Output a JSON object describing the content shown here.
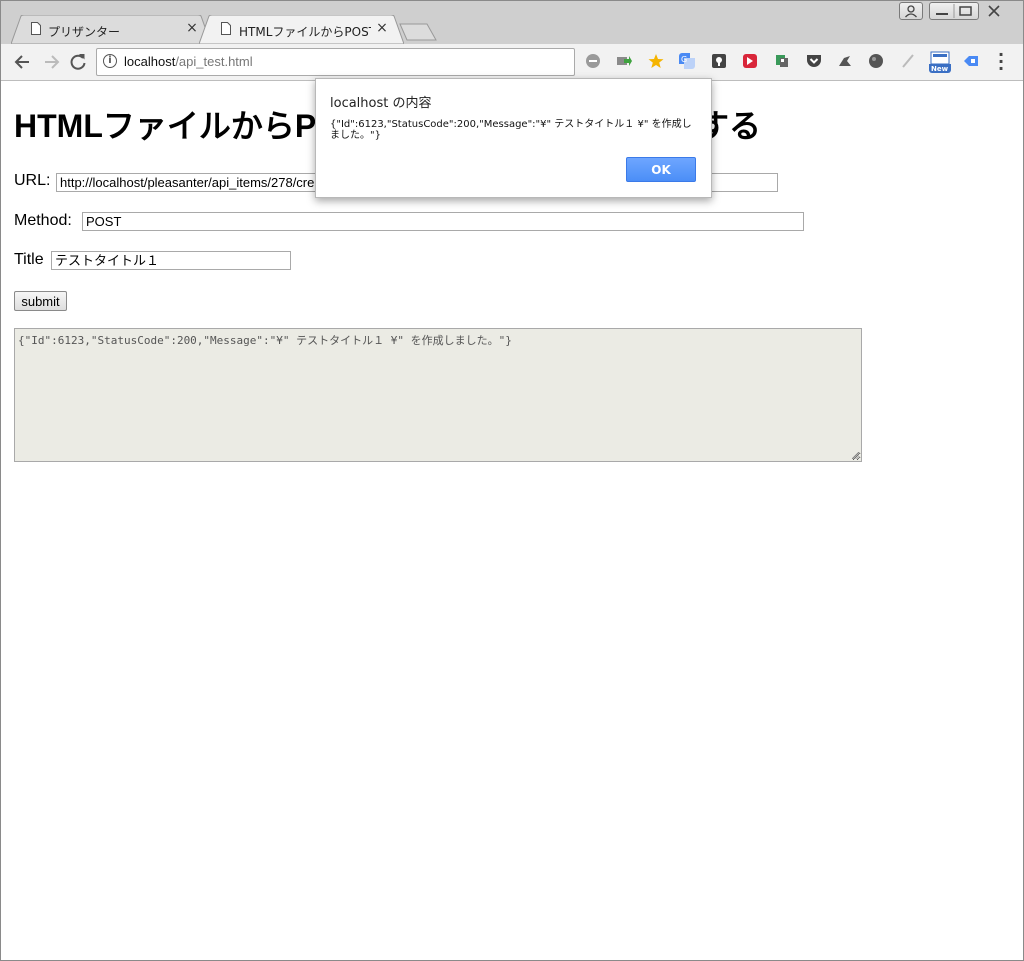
{
  "browser": {
    "tabs": [
      {
        "title": "プリザンター",
        "close": "×"
      },
      {
        "title": "HTMLファイルからPOSTでよ",
        "close": "×"
      }
    ],
    "address": {
      "host": "localhost",
      "path": "/api_test.html"
    },
    "icons": [
      "back-arrow",
      "forward-arrow",
      "reload",
      "info",
      "ext-gray-circle",
      "ext-green-arrow",
      "bookmark-star",
      "ext-translate",
      "ext-key",
      "ext-red",
      "ext-puzzle",
      "pocket",
      "ext-bird",
      "ext-globe",
      "ext-feather",
      "ext-new",
      "ext-blue-tag",
      "menu"
    ],
    "new_badge": "New"
  },
  "page": {
    "heading": "HTMLファイルからP",
    "heading_tail": "する",
    "url_label": "URL:",
    "url_value": "http://localhost/pleasanter/api_items/278/cre",
    "method_label": "Method:",
    "method_value": "POST",
    "title_label": "Title",
    "title_value": "テストタイトル１",
    "submit_label": "submit",
    "result_text": "{\"Id\":6123,\"StatusCode\":200,\"Message\":\"¥\" テストタイトル１ ¥\" を作成しました。\"}"
  },
  "dialog": {
    "title": "localhost の内容",
    "message": "{\"Id\":6123,\"StatusCode\":200,\"Message\":\"¥\" テストタイトル１ ¥\" を作成しました。\"}",
    "ok_label": "OK"
  },
  "colors": {
    "accent": "#4b8ef7",
    "readonly_bg": "#ebebe4"
  }
}
